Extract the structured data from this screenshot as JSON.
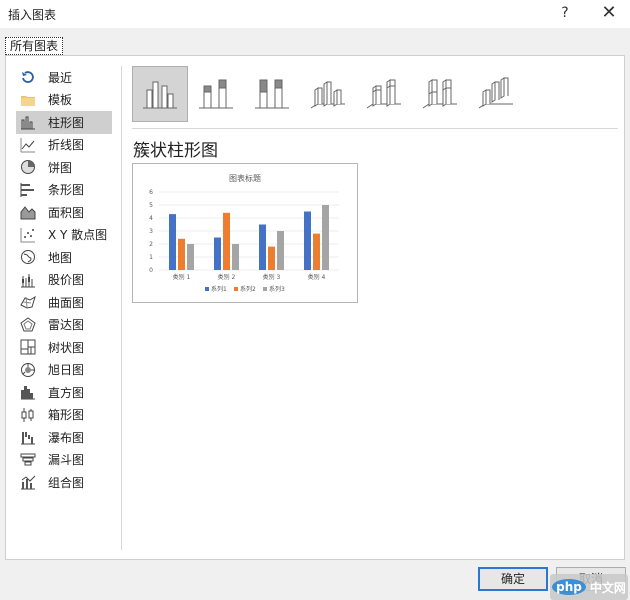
{
  "window": {
    "title": "插入图表",
    "help": "?",
    "close": "✕"
  },
  "tabs": [
    {
      "label": "所有图表"
    }
  ],
  "sidebar": {
    "items": [
      {
        "label": "最近",
        "icon": "recent-icon"
      },
      {
        "label": "模板",
        "icon": "folder-icon"
      },
      {
        "label": "柱形图",
        "icon": "column-chart-icon",
        "selected": true
      },
      {
        "label": "折线图",
        "icon": "line-chart-icon"
      },
      {
        "label": "饼图",
        "icon": "pie-chart-icon"
      },
      {
        "label": "条形图",
        "icon": "bar-chart-icon"
      },
      {
        "label": "面积图",
        "icon": "area-chart-icon"
      },
      {
        "label": "X Y 散点图",
        "icon": "scatter-chart-icon"
      },
      {
        "label": "地图",
        "icon": "map-chart-icon"
      },
      {
        "label": "股价图",
        "icon": "stock-chart-icon"
      },
      {
        "label": "曲面图",
        "icon": "surface-chart-icon"
      },
      {
        "label": "雷达图",
        "icon": "radar-chart-icon"
      },
      {
        "label": "树状图",
        "icon": "treemap-chart-icon"
      },
      {
        "label": "旭日图",
        "icon": "sunburst-chart-icon"
      },
      {
        "label": "直方图",
        "icon": "histogram-chart-icon"
      },
      {
        "label": "箱形图",
        "icon": "box-whisker-chart-icon"
      },
      {
        "label": "瀑布图",
        "icon": "waterfall-chart-icon"
      },
      {
        "label": "漏斗图",
        "icon": "funnel-chart-icon"
      },
      {
        "label": "组合图",
        "icon": "combo-chart-icon"
      }
    ]
  },
  "subtypes": [
    {
      "icon": "clustered-column-icon",
      "selected": true
    },
    {
      "icon": "stacked-column-icon"
    },
    {
      "icon": "100-stacked-column-icon"
    },
    {
      "icon": "3d-clustered-column-icon"
    },
    {
      "icon": "3d-stacked-column-icon"
    },
    {
      "icon": "3d-100-stacked-column-icon"
    },
    {
      "icon": "3d-column-icon"
    }
  ],
  "main": {
    "heading": "簇状柱形图"
  },
  "chart_data": {
    "type": "bar",
    "title": "图表标题",
    "categories": [
      "类别 1",
      "类别 2",
      "类别 3",
      "类别 4"
    ],
    "series": [
      {
        "name": "系列1",
        "values": [
          4.3,
          2.5,
          3.5,
          4.5
        ],
        "color": "#4472c4"
      },
      {
        "name": "系列2",
        "values": [
          2.4,
          4.4,
          1.8,
          2.8
        ],
        "color": "#ed7d31"
      },
      {
        "name": "系列3",
        "values": [
          2,
          2,
          3,
          5
        ],
        "color": "#a5a5a5"
      }
    ],
    "ylim": [
      0,
      6
    ],
    "yticks": [
      "0",
      "1",
      "2",
      "3",
      "4",
      "5",
      "6"
    ],
    "grid": true,
    "legend": "bottom"
  },
  "buttons": {
    "ok": "确定",
    "cancel": "取消"
  },
  "watermark": {
    "badge": "php",
    "text": "中文网"
  },
  "colors": {
    "accent": "#2b77d4",
    "selected_bg": "#cfcfcf"
  }
}
